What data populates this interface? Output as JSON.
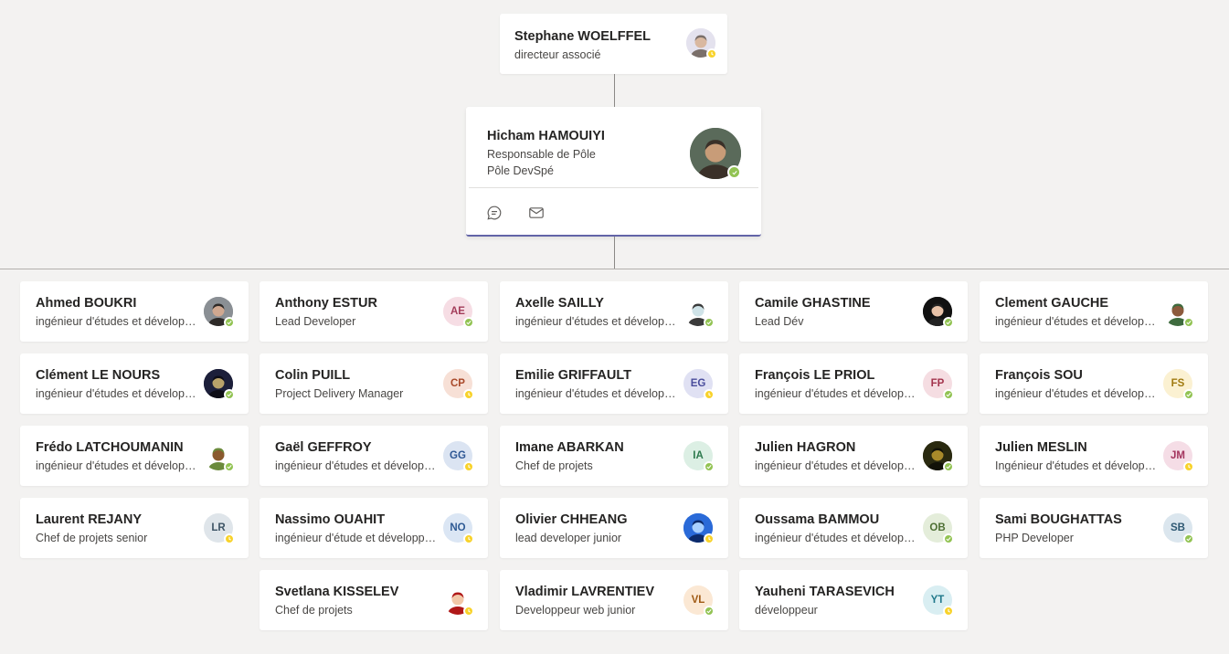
{
  "manager": {
    "name": "Stephane WOELFFEL",
    "title": "directeur associé",
    "avatar": {
      "type": "photo",
      "colors": [
        "#e4e2ee",
        "#7a6f6a",
        "#d9b8a0"
      ]
    },
    "status": "away"
  },
  "focus": {
    "name": "Hicham HAMOUIYI",
    "title": "Responsable de Pôle",
    "department": "Pôle DevSpé",
    "avatar": {
      "type": "photo",
      "colors": [
        "#5a6a5a",
        "#3a3028",
        "#c89c78"
      ]
    },
    "status": "available",
    "actions": [
      {
        "name": "chat-icon"
      },
      {
        "name": "mail-icon"
      }
    ]
  },
  "reports": [
    {
      "name": "Ahmed BOUKRI",
      "title": "ingénieur d'études et développement",
      "status": "available",
      "avatar": {
        "type": "photo",
        "colors": [
          "#8a8f94",
          "#2e2a28",
          "#d0a890"
        ]
      }
    },
    {
      "name": "Anthony ESTUR",
      "title": "Lead Developer",
      "status": "available",
      "avatar": {
        "type": "initials",
        "initials": "AE",
        "bg": "#f6dde4",
        "fg": "#a33d5a"
      }
    },
    {
      "name": "Axelle SAILLY",
      "title": "ingénieur d'études et développement",
      "status": "available",
      "avatar": {
        "type": "photo",
        "colors": [
          "#ffffff",
          "#3b3b3b",
          "#cfe3e8"
        ]
      }
    },
    {
      "name": "Camile GHASTINE",
      "title": "Lead Dév",
      "status": "available",
      "avatar": {
        "type": "photo",
        "colors": [
          "#111111",
          "#222222",
          "#e8c2a8"
        ]
      }
    },
    {
      "name": "Clement GAUCHE",
      "title": "ingénieur d'études et développement",
      "status": "available",
      "avatar": {
        "type": "photo",
        "colors": [
          "#ffffff",
          "#3e6b3e",
          "#8c5a3c"
        ]
      }
    },
    {
      "name": "Clément LE NOURS",
      "title": "ingénieur d'études et développement",
      "status": "available",
      "avatar": {
        "type": "photo",
        "colors": [
          "#1c1f3a",
          "#0d0d16",
          "#b8a26a"
        ]
      }
    },
    {
      "name": "Colin PUILL",
      "title": "Project Delivery Manager",
      "status": "away",
      "avatar": {
        "type": "initials",
        "initials": "CP",
        "bg": "#f7e0d6",
        "fg": "#a9492a"
      }
    },
    {
      "name": "Emilie GRIFFAULT",
      "title": "ingénieur d'études et développement",
      "status": "away",
      "avatar": {
        "type": "initials",
        "initials": "EG",
        "bg": "#e0e1f3",
        "fg": "#4a4d9c"
      }
    },
    {
      "name": "François LE PRIOL",
      "title": "ingénieur d'études et développement",
      "status": "available",
      "avatar": {
        "type": "initials",
        "initials": "FP",
        "bg": "#f5dde2",
        "fg": "#a3344d"
      }
    },
    {
      "name": "François SOU",
      "title": "ingénieur d'études et développement",
      "status": "available",
      "avatar": {
        "type": "initials",
        "initials": "FS",
        "bg": "#fbf1d2",
        "fg": "#a07a10"
      }
    },
    {
      "name": "Frédo LATCHOUMANIN",
      "title": "ingénieur d'études et développement",
      "status": "available",
      "avatar": {
        "type": "photo",
        "colors": [
          "#ffffff",
          "#6b8a3c",
          "#8a5a2e"
        ]
      }
    },
    {
      "name": "Gaël GEFFROY",
      "title": "ingénieur d'études et développement",
      "status": "away",
      "avatar": {
        "type": "initials",
        "initials": "GG",
        "bg": "#dbe4f2",
        "fg": "#2f5895"
      }
    },
    {
      "name": "Imane ABARKAN",
      "title": "Chef de projets",
      "status": "available",
      "avatar": {
        "type": "initials",
        "initials": "IA",
        "bg": "#dcefe4",
        "fg": "#2e7a4e"
      }
    },
    {
      "name": "Julien HAGRON",
      "title": "ingénieur d'études et développement",
      "status": "available",
      "avatar": {
        "type": "photo",
        "colors": [
          "#2a2a10",
          "#121208",
          "#a88a2a"
        ]
      }
    },
    {
      "name": "Julien MESLIN",
      "title": "Ingénieur d'études et développement",
      "status": "away",
      "avatar": {
        "type": "initials",
        "initials": "JM",
        "bg": "#f5dde6",
        "fg": "#a3345d"
      }
    },
    {
      "name": "Laurent REJANY",
      "title": "Chef de projets senior",
      "status": "away",
      "avatar": {
        "type": "initials",
        "initials": "LR",
        "bg": "#dfe5ea",
        "fg": "#3e5566"
      }
    },
    {
      "name": "Nassimo OUAHIT",
      "title": "ingénieur d'étude et développement",
      "status": "away",
      "avatar": {
        "type": "initials",
        "initials": "NO",
        "bg": "#dbe6f4",
        "fg": "#2e5a94"
      }
    },
    {
      "name": "Olivier CHHEANG",
      "title": "lead developer junior",
      "status": "away",
      "avatar": {
        "type": "photo",
        "colors": [
          "#2a6ad8",
          "#0c2a6a",
          "#a8d0ff"
        ]
      }
    },
    {
      "name": "Oussama BAMMOU",
      "title": "ingénieur d'études et développement",
      "status": "available",
      "avatar": {
        "type": "initials",
        "initials": "OB",
        "bg": "#e4edda",
        "fg": "#4e7034"
      }
    },
    {
      "name": "Sami BOUGHATTAS",
      "title": "PHP Developer",
      "status": "available",
      "avatar": {
        "type": "initials",
        "initials": "SB",
        "bg": "#dbe6ee",
        "fg": "#2e5872"
      }
    },
    {
      "name": "Svetlana KISSELEV",
      "title": "Chef de projets",
      "status": "away",
      "avatar": {
        "type": "photo",
        "colors": [
          "#ffffff",
          "#b01818",
          "#f2c8a8"
        ]
      }
    },
    {
      "name": "Vladimir LAVRENTIEV",
      "title": "Developpeur web junior",
      "status": "available",
      "avatar": {
        "type": "initials",
        "initials": "VL",
        "bg": "#fbe8d4",
        "fg": "#a05a14"
      }
    },
    {
      "name": "Yauheni TARASEVICH",
      "title": "développeur",
      "status": "away",
      "avatar": {
        "type": "initials",
        "initials": "YT",
        "bg": "#d9eef2",
        "fg": "#20788a"
      }
    }
  ]
}
